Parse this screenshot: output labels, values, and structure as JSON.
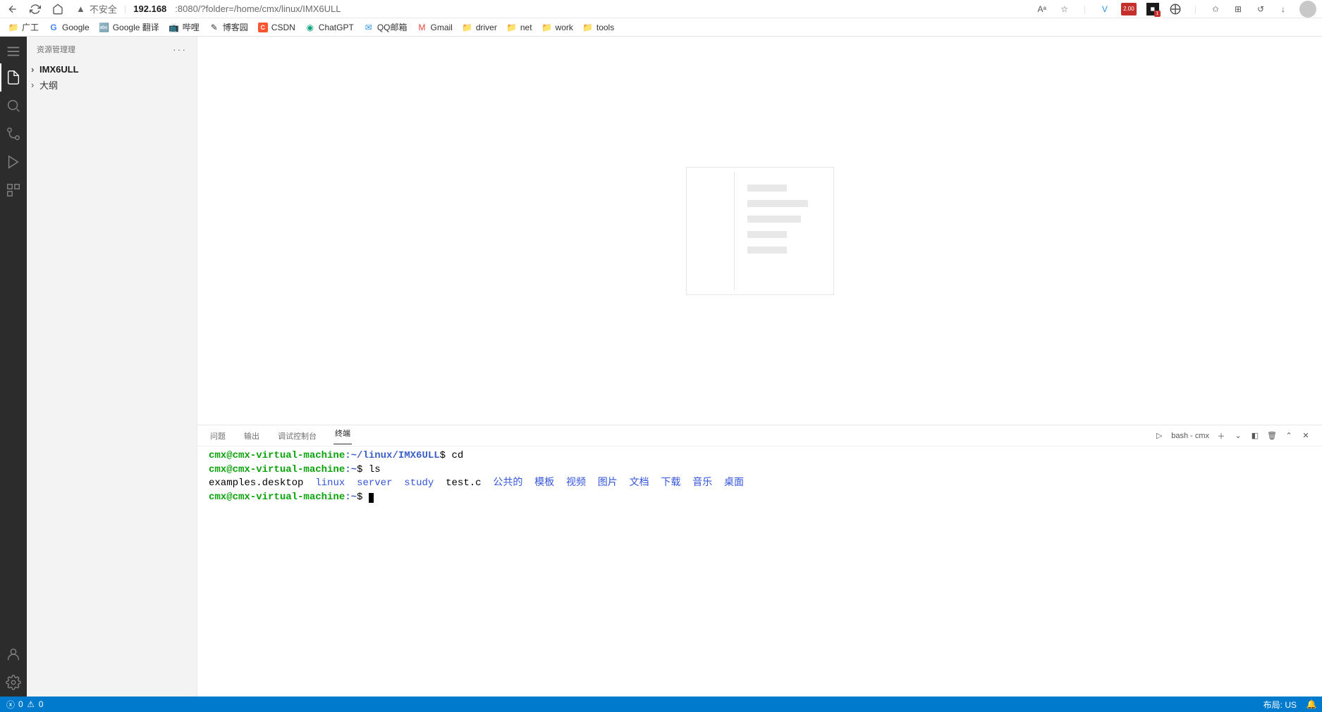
{
  "browser": {
    "security_label": "不安全",
    "url_ip": "192.168",
    "url_mask": "        ",
    "url_port_path": ":8080/?folder=/home/cmx/linux/IMX6ULL",
    "ext_badge": "2.00",
    "font_mode": "Aᵃ"
  },
  "bookmarks": [
    {
      "icon": "folder",
      "label": "广工"
    },
    {
      "icon": "g",
      "label": "Google"
    },
    {
      "icon": "gt",
      "label": "Google 翻译"
    },
    {
      "icon": "b",
      "label": "哔哩"
    },
    {
      "icon": "bky",
      "label": "博客园"
    },
    {
      "icon": "csdn",
      "label": "CSDN"
    },
    {
      "icon": "cg",
      "label": "ChatGPT"
    },
    {
      "icon": "qq",
      "label": "QQ邮箱"
    },
    {
      "icon": "gmail",
      "label": "Gmail"
    },
    {
      "icon": "folder",
      "label": "driver"
    },
    {
      "icon": "folder",
      "label": "net"
    },
    {
      "icon": "folder",
      "label": "work"
    },
    {
      "icon": "folder",
      "label": "tools"
    }
  ],
  "sidebar": {
    "title": "资源管理理",
    "tree": [
      {
        "label": "IMX6ULL",
        "bold": true
      },
      {
        "label": "大纲",
        "bold": false
      }
    ]
  },
  "panel": {
    "tabs": [
      "问题",
      "输出",
      "调试控制台",
      "终端"
    ],
    "active_tab": 3,
    "shell_label": "bash - cmx"
  },
  "terminal": {
    "lines": [
      {
        "prompt": "cmx@cmx-virtual-machine",
        "path": ":~/linux/IMX6ULL",
        "cmd": "cd"
      },
      {
        "prompt": "cmx@cmx-virtual-machine",
        "path": ":~",
        "cmd": "ls"
      }
    ],
    "ls_plain": [
      "examples.desktop"
    ],
    "ls_dirs": [
      "linux",
      "server",
      "study"
    ],
    "ls_plain2": [
      "test.c"
    ],
    "ls_zh": [
      "公共的",
      "模板",
      "视频",
      "图片",
      "文档",
      "下载",
      "音乐",
      "桌面"
    ],
    "final_prompt": "cmx@cmx-virtual-machine",
    "final_path": ":~"
  },
  "status": {
    "errors": "0",
    "warnings": "0",
    "layout": "布局: US"
  }
}
